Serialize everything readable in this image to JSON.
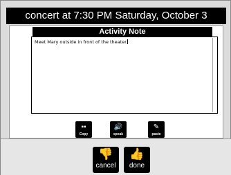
{
  "window": {
    "title": "concert at 7:30 PM Saturday, October 3"
  },
  "note": {
    "header": "Activity Note",
    "text": "Meet Mary outside in front of the theater."
  },
  "toolbar": {
    "copy_label": "Copy",
    "speak_label": "speak",
    "paste_label": "paste",
    "copy_icon": "copy-icon",
    "speak_icon": "speaker-icon",
    "paste_icon": "paste-icon"
  },
  "actions": {
    "cancel_label": "cancel",
    "done_label": "done",
    "cancel_icon": "thumbs-down-icon",
    "done_icon": "thumbs-up-icon"
  }
}
